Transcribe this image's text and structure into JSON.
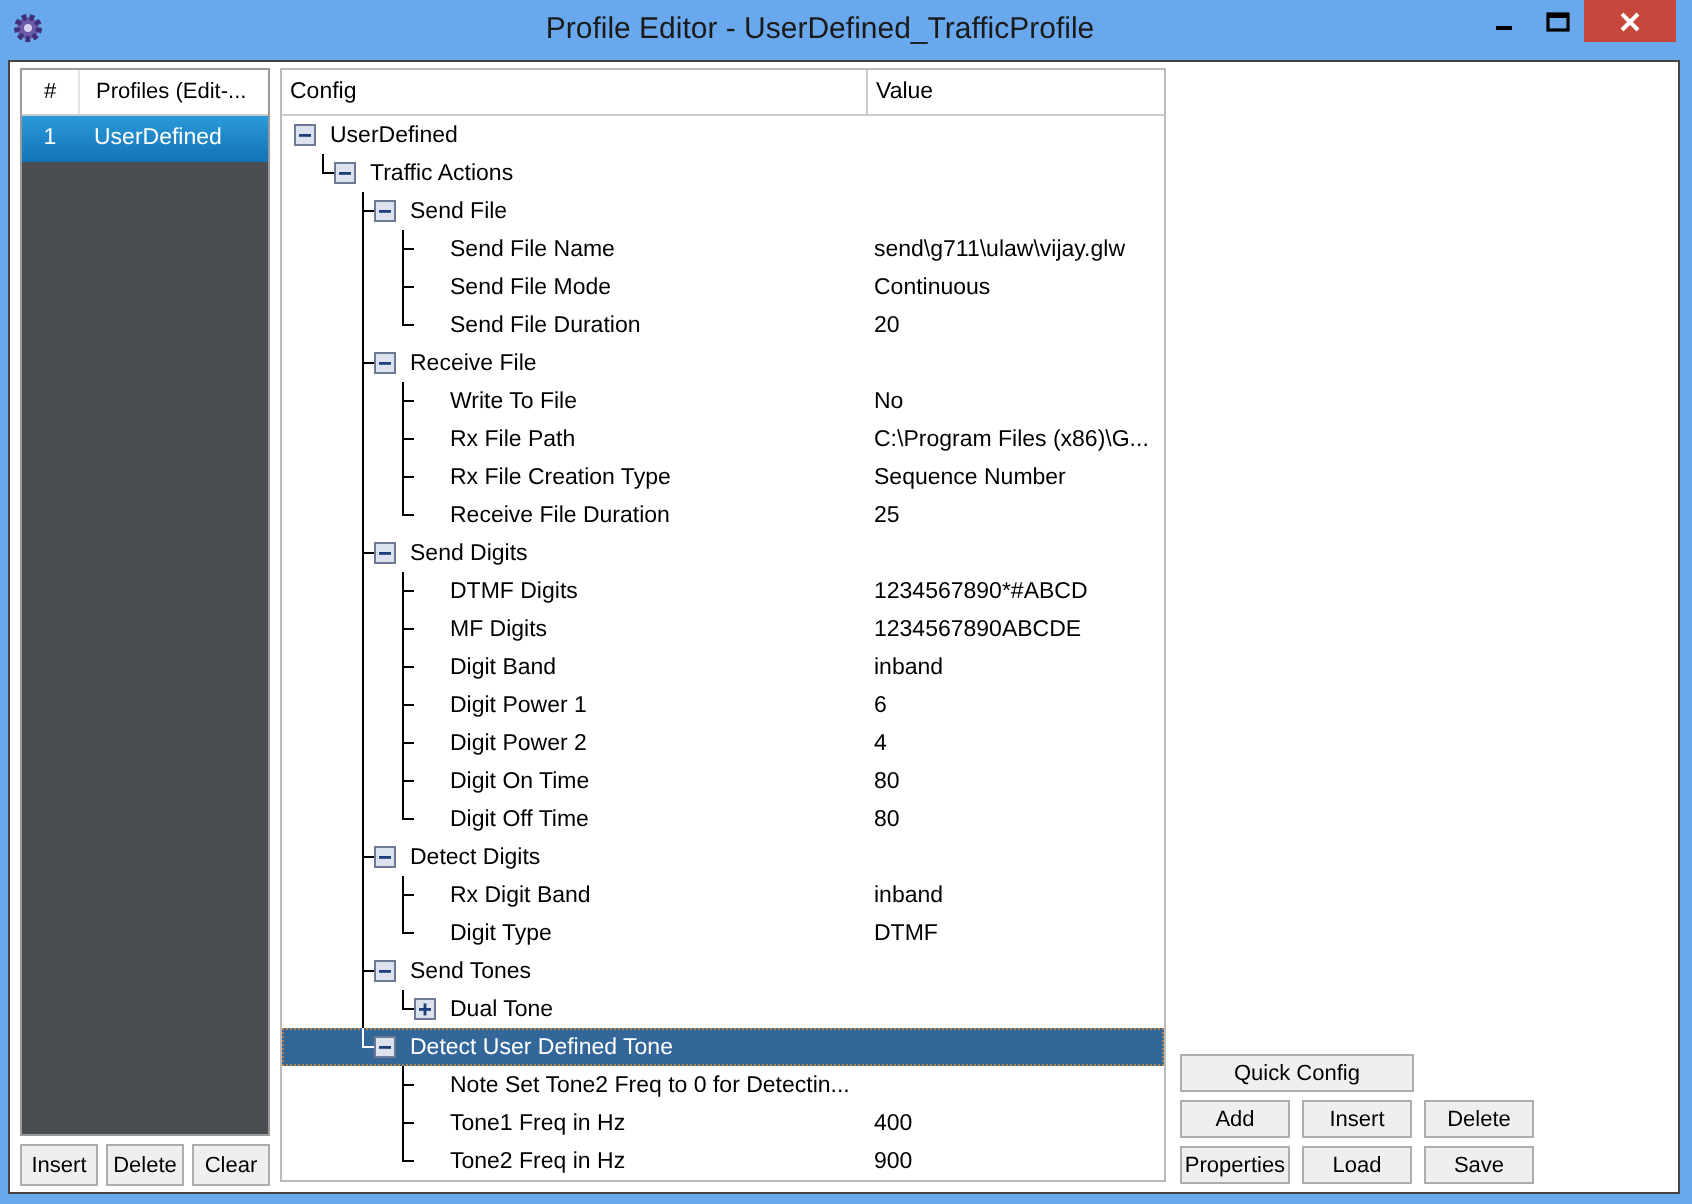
{
  "window": {
    "title": "Profile Editor - UserDefined_TrafficProfile"
  },
  "profiles": {
    "columns": [
      "#",
      "Profiles (Edit-..."
    ],
    "rows": [
      {
        "index": "1",
        "name": "UserDefined",
        "selected": true
      }
    ],
    "buttons": [
      "Insert",
      "Delete",
      "Clear"
    ]
  },
  "config": {
    "columns": [
      "Config",
      "Value"
    ],
    "tree": [
      {
        "label": "UserDefined",
        "expanded": true,
        "selected": false,
        "children": [
          {
            "label": "Traffic Actions",
            "expanded": true,
            "selected": false,
            "children": [
              {
                "label": "Send File",
                "expanded": true,
                "selected": false,
                "children": [
                  {
                    "label": "Send File Name",
                    "value": "send\\g711\\ulaw\\vijay.glw",
                    "selected": false
                  },
                  {
                    "label": "Send File Mode",
                    "value": "Continuous",
                    "selected": false
                  },
                  {
                    "label": "Send File Duration",
                    "value": "20",
                    "selected": false
                  }
                ]
              },
              {
                "label": "Receive File",
                "expanded": true,
                "selected": false,
                "children": [
                  {
                    "label": "Write To File",
                    "value": "No",
                    "selected": false
                  },
                  {
                    "label": "Rx File Path",
                    "value": "C:\\Program Files (x86)\\G...",
                    "selected": false
                  },
                  {
                    "label": "Rx File Creation Type",
                    "value": "Sequence Number",
                    "selected": false
                  },
                  {
                    "label": "Receive File Duration",
                    "value": "25",
                    "selected": false
                  }
                ]
              },
              {
                "label": "Send Digits",
                "expanded": true,
                "selected": false,
                "children": [
                  {
                    "label": "DTMF Digits",
                    "value": "1234567890*#ABCD",
                    "selected": false
                  },
                  {
                    "label": "MF Digits",
                    "value": "1234567890ABCDE",
                    "selected": false
                  },
                  {
                    "label": "Digit Band",
                    "value": "inband",
                    "selected": false
                  },
                  {
                    "label": "Digit Power 1",
                    "value": "6",
                    "selected": false
                  },
                  {
                    "label": "Digit Power 2",
                    "value": "4",
                    "selected": false
                  },
                  {
                    "label": "Digit On Time",
                    "value": "80",
                    "selected": false
                  },
                  {
                    "label": "Digit Off Time",
                    "value": "80",
                    "selected": false
                  }
                ]
              },
              {
                "label": "Detect Digits",
                "expanded": true,
                "selected": false,
                "children": [
                  {
                    "label": "Rx Digit Band",
                    "value": "inband",
                    "selected": false
                  },
                  {
                    "label": "Digit Type",
                    "value": "DTMF",
                    "selected": false
                  }
                ]
              },
              {
                "label": "Send Tones",
                "expanded": true,
                "selected": false,
                "children": [
                  {
                    "label": "Dual Tone",
                    "expanded": false,
                    "selected": false
                  }
                ]
              },
              {
                "label": "Detect User Defined Tone",
                "expanded": true,
                "selected": true,
                "children": [
                  {
                    "label": "Note Set Tone2 Freq to 0 for Detectin...",
                    "selected": false
                  },
                  {
                    "label": "Tone1 Freq in Hz",
                    "value": "400",
                    "selected": false
                  },
                  {
                    "label": "Tone2 Freq in Hz",
                    "value": "900",
                    "selected": false
                  }
                ]
              }
            ]
          }
        ]
      }
    ]
  },
  "actions": {
    "quick_config": "Quick Config",
    "rows": [
      [
        "Add",
        "Insert",
        "Delete"
      ],
      [
        "Properties",
        "Load",
        "Save"
      ]
    ]
  }
}
